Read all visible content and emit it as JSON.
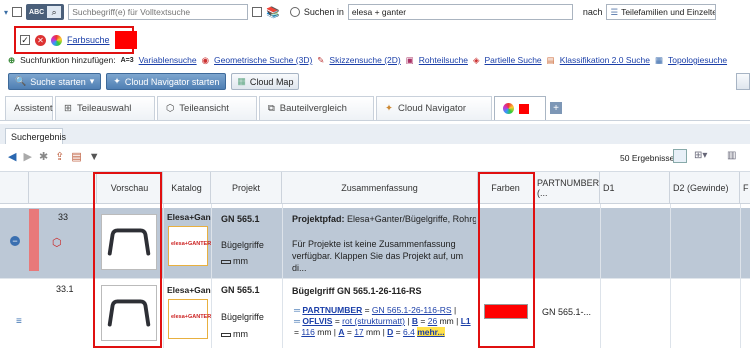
{
  "toolbar": {
    "mode_label": "ABC",
    "search_placeholder": "Suchbegriff(e) für Volltextsuche",
    "search_in_label": "Suchen in",
    "search_in_value": "elesa + ganter",
    "nach_label": "nach",
    "nach_value": "Teilefamilien und Einzelte"
  },
  "color_search": {
    "label": "Farbsuche",
    "color": "#ff0000"
  },
  "add_functions": {
    "label": "Suchfunktion hinzufügen:",
    "items": [
      "Variablensuche",
      "Geometrische Suche (3D)",
      "Skizzensuche (2D)",
      "Rohteilsuche",
      "Partielle Suche",
      "Klassifikation 2.0 Suche",
      "Topologiesuche"
    ]
  },
  "actions": {
    "start": "Suche starten",
    "navigator": "Cloud Navigator starten",
    "map": "Cloud Map"
  },
  "tabs": [
    "Assistent",
    "Teileauswahl",
    "Teileansicht",
    "Bauteilvergleich",
    "Cloud Navigator"
  ],
  "results_tab": "Suchergebnis",
  "result_count": "50 Ergebnisse",
  "columns": [
    "Vorschau",
    "Katalog",
    "Projekt",
    "Zusammenfassung",
    "Farben",
    "PARTNUMBER (...",
    "D1",
    "D2 (Gewinde)",
    "F"
  ],
  "rows": [
    {
      "num": "33",
      "catalog_name": "Elesa+Gan",
      "catalog_logo": "elesa+GANTER",
      "project": "GN 565.1",
      "project_sub": "Bügelgriffe",
      "unit": "mm",
      "summary_title": "Projektpfad:",
      "summary_path": "Elesa+Ganter/Bügelgriffe, Rohrg...",
      "summary_text": "Für Projekte ist keine Zusammenfassung verfügbar. Klappen Sie das Projekt auf, um di..."
    },
    {
      "num": "33.1",
      "catalog_name": "Elesa+Gan",
      "catalog_logo": "elesa+GANTER",
      "project": "GN 565.1",
      "project_sub": "Bügelgriffe",
      "unit": "mm",
      "summary_title": "Bügelgriff GN 565.1-26-116-RS",
      "partnumber_label": "PARTNUMBER",
      "partnumber_value": "GN 565.1-26-116-RS",
      "oflvis_label": "OFLVIS",
      "oflvis_value": "rot (strukturmatt)",
      "b_label": "B",
      "b_value": "26",
      "l1_label": "L1",
      "l1_value": "116",
      "a_label": "A",
      "a_value": "17",
      "d_label": "D",
      "d_value": "6.4",
      "unit_mm": "mm",
      "more": "mehr...",
      "color": "#ff0000",
      "partnumber_col": "GN 565.1-..."
    }
  ]
}
